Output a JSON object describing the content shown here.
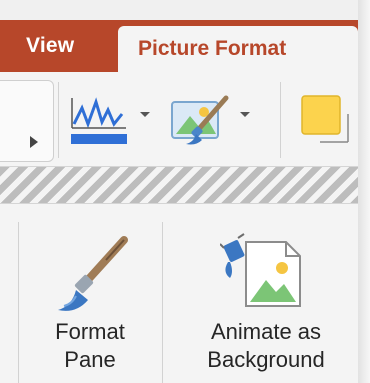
{
  "ribbon": {
    "tabs": [
      {
        "label": "View",
        "active": false
      },
      {
        "label": "Picture Format",
        "active": true
      }
    ],
    "accent_color": "#b7472a",
    "row1": {
      "left_group_icon": "play-arrow-icon",
      "buttons": [
        {
          "icon": "chart-waveform-icon",
          "has_dropdown": true
        },
        {
          "icon": "picture-brush-icon",
          "has_dropdown": true
        },
        {
          "icon": "yellow-shape-icon",
          "has_dropdown": false
        }
      ]
    },
    "row2": {
      "buttons": [
        {
          "icon": "paintbrush-icon",
          "label_line1": "Format",
          "label_line2": "Pane"
        },
        {
          "icon": "animate-background-icon",
          "label_line1": "Animate as",
          "label_line2": "Background"
        }
      ]
    }
  }
}
